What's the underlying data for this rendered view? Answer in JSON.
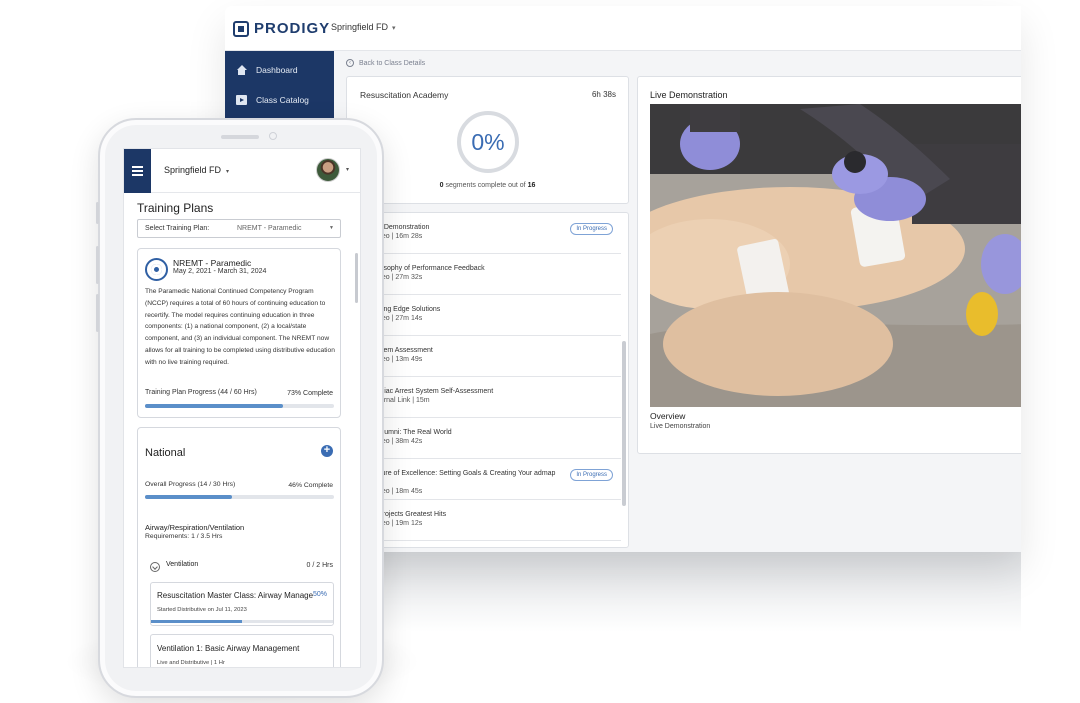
{
  "desktop": {
    "brand": "PRODIGY",
    "org": "Springfield FD",
    "nav": [
      {
        "label": "Dashboard",
        "icon": "home-icon"
      },
      {
        "label": "Class Catalog",
        "icon": "video-icon"
      }
    ],
    "back_link": "Back to Class Details",
    "course": {
      "title": "Resuscitation Academy",
      "time": "6h 38s",
      "progress_pct": "0%",
      "progress_value": 0,
      "segments_done": "0",
      "segments_text_a": " segments complete out of ",
      "segments_total": "16"
    },
    "segments": [
      {
        "title": "e Demonstration",
        "sub": "deo | 16m 28s",
        "status": "In Progress"
      },
      {
        "title": "losophy of Performance Feedback",
        "sub": "deo | 27m 32s",
        "status": ""
      },
      {
        "title": "tting Edge Solutions",
        "sub": "deo | 27m 14s",
        "status": ""
      },
      {
        "title": "stem Assessment",
        "sub": "deo | 13m 49s",
        "status": ""
      },
      {
        "title": "rdiac Arrest System Self-Assessment",
        "sub": "ternal Link | 15m",
        "status": ""
      },
      {
        "title": "Alumni: The Real World",
        "sub": "deo | 38m 42s",
        "status": ""
      },
      {
        "title": "lture of Excellence: Setting Goals & Creating Your admap",
        "sub": "deo | 18m 45s",
        "status": "In Progress"
      },
      {
        "title": "Projects Greatest Hits",
        "sub": "deo | 19m 12s",
        "status": ""
      }
    ],
    "video": {
      "title": "Live Demonstration",
      "overview_label": "Overview",
      "overview_text": "Live Demonstration"
    }
  },
  "mobile": {
    "org": "Springfield FD",
    "page_title": "Training Plans",
    "select_label": "Select Training Plan:",
    "select_value": "NREMT - Paramedic",
    "plan": {
      "name": "NREMT - Paramedic",
      "dates": "May 2, 2021 - March 31, 2024",
      "description": "The Paramedic National Continued Competency Program (NCCP) requires a total of 60 hours of continuing education to recertify. The model requires continuing education in three components: (1) a national component, (2) a local/state component, and (3) an individual component. The NREMT now allows for all training to be completed using distributive education with no live training required.",
      "progress_label": "Training Plan Progress (44 / 60 Hrs)",
      "progress_pct": "73% Complete",
      "progress_value": 0.73
    },
    "national": {
      "title": "National",
      "progress_label": "Overall Progress (14 / 30 Hrs)",
      "progress_pct": "46% Complete",
      "progress_value": 0.46,
      "category": "Airway/Respiration/Ventilation",
      "requirements": "Requirements: 1 / 3.5 Hrs",
      "topic": "Ventilation",
      "topic_hours": "0 / 2 Hrs",
      "courses": [
        {
          "title": "Resuscitation Master Class: Airway Management",
          "pct": "50%",
          "sub": "Started Distributive on Jul 11, 2023",
          "progress_value": 0.5
        },
        {
          "title": "Ventilation 1: Basic Airway Management",
          "pct": "",
          "sub": "Live and Distributive | 1 Hr"
        }
      ]
    }
  },
  "colors": {
    "navy": "#1c3766",
    "accent": "#3a6cb3",
    "progress": "#5b8fc9"
  }
}
